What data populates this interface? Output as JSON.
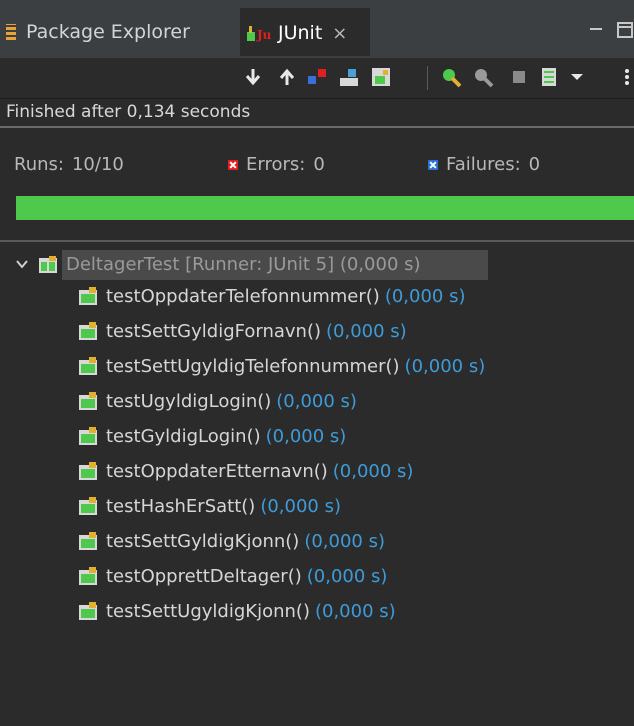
{
  "tabs": [
    {
      "label": "Package Explorer",
      "icon": "package-explorer-icon"
    },
    {
      "label": "JUnit",
      "icon": "junit-icon",
      "close": "×",
      "active": true
    }
  ],
  "status": {
    "text": "Finished after 0,134 seconds"
  },
  "counters": {
    "runs_label": "Runs:",
    "runs_value": "10/10",
    "errors_label": "Errors:",
    "errors_value": "0",
    "failures_label": "Failures:",
    "failures_value": "0"
  },
  "progress": {
    "fraction": 1.0,
    "color": "#4ec94e"
  },
  "tree": {
    "root": {
      "label": "DeltagerTest [Runner: JUnit 5] (0,000 s)"
    },
    "cases": [
      {
        "name": "testOppdaterTelefonnummer()",
        "time": "(0,000 s)"
      },
      {
        "name": "testSettGyldigFornavn()",
        "time": "(0,000 s)"
      },
      {
        "name": "testSettUgyldigTelefonnummer()",
        "time": "(0,000 s)"
      },
      {
        "name": "testUgyldigLogin()",
        "time": "(0,000 s)"
      },
      {
        "name": "testGyldigLogin()",
        "time": "(0,000 s)"
      },
      {
        "name": "testOppdaterEtternavn()",
        "time": "(0,000 s)"
      },
      {
        "name": "testHashErSatt()",
        "time": "(0,000 s)"
      },
      {
        "name": "testSettGyldigKjonn()",
        "time": "(0,000 s)"
      },
      {
        "name": "testOpprettDeltager()",
        "time": "(0,000 s)"
      },
      {
        "name": "testSettUgyldigKjonn()",
        "time": "(0,000 s)"
      }
    ]
  },
  "colors": {
    "pass": "#4ec94e",
    "error": "#e02020",
    "failure": "#2b6fd6",
    "time": "#3f9bd8"
  }
}
